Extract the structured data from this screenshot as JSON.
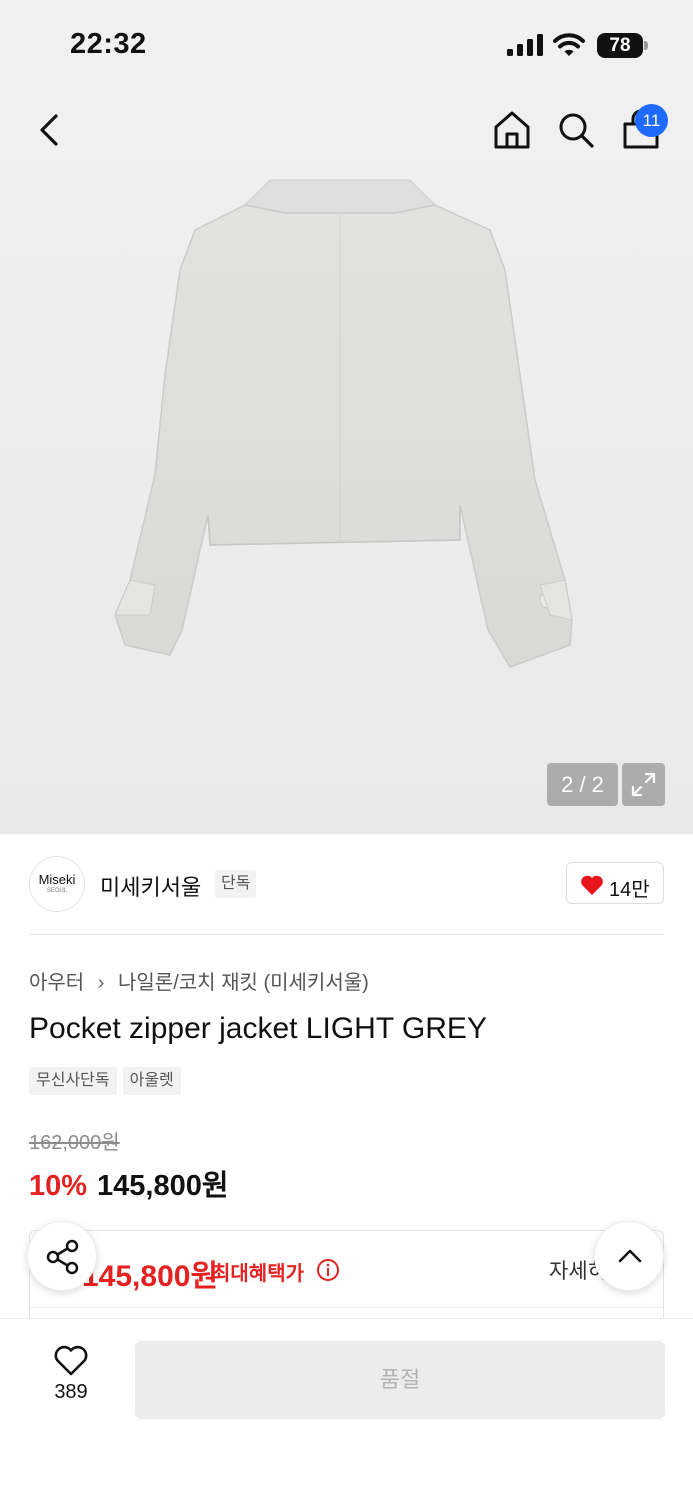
{
  "status_bar": {
    "time": "22:32",
    "battery": "78"
  },
  "nav": {
    "cart_count": "11"
  },
  "gallery": {
    "counter": "2 / 2"
  },
  "brand": {
    "logo_text": "Miseki",
    "logo_sub": "SEOUL",
    "name": "미세키서울",
    "tag": "단독",
    "likes": "14만"
  },
  "breadcrumb": {
    "category": "아우터",
    "sub_category": "나일론/코치 재킷 (미세키서울)"
  },
  "product": {
    "title": "Pocket zipper jacket LIGHT GREY",
    "tags": [
      "무신사단독",
      "아울렛"
    ],
    "original_price": "162,000원",
    "discount": "10%",
    "sale_price": "145,800원"
  },
  "benefit": {
    "price": "145,800원",
    "label": "최대혜택가",
    "detail": "자세히"
  },
  "bottom_bar": {
    "wish_count": "389",
    "buy_label": "품절"
  },
  "colors": {
    "accent_red": "#e52222",
    "badge_blue": "#1f6bff",
    "heart_red": "#e8141c"
  }
}
